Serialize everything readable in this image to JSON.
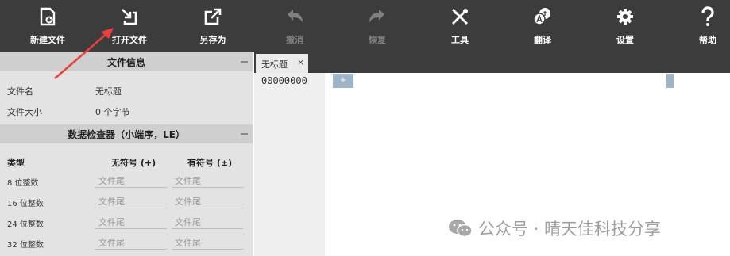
{
  "toolbar": {
    "new_file": "新建文件",
    "open_file": "打开文件",
    "save_as": "另存为",
    "undo": "撤消",
    "redo": "恢复",
    "tools": "工具",
    "translate": "翻译",
    "settings": "设置",
    "help": "帮助"
  },
  "file_info": {
    "title": "文件信息",
    "name_label": "文件名",
    "name_value": "无标题",
    "size_label": "文件大小",
    "size_value": "0 个字节"
  },
  "inspector": {
    "title": "数据检查器（小端序，LE）",
    "col_type": "类型",
    "col_unsigned": "无符号 (+)",
    "col_signed": "有符号 (±)",
    "rows": [
      {
        "type": "8 位整数",
        "unsigned": "文件尾",
        "signed": "文件尾"
      },
      {
        "type": "16 位整数",
        "unsigned": "文件尾",
        "signed": "文件尾"
      },
      {
        "type": "24 位整数",
        "unsigned": "文件尾",
        "signed": "文件尾"
      },
      {
        "type": "32 位整数",
        "unsigned": "文件尾",
        "signed": "文件尾"
      }
    ]
  },
  "editor": {
    "tab_label": "无标题",
    "tab_close": "×",
    "offset": "00000000",
    "cursor_glyph": "+"
  },
  "watermark": {
    "text": "公众号 · 晴天佳科技分享"
  },
  "colors": {
    "toolbar_bg": "#3c3c3c",
    "panel_bg": "#e3e3e3",
    "panel_header_bg": "#cfcfcf",
    "cursor_accent": "#9db4c8",
    "annotation_arrow": "#e8413c"
  }
}
